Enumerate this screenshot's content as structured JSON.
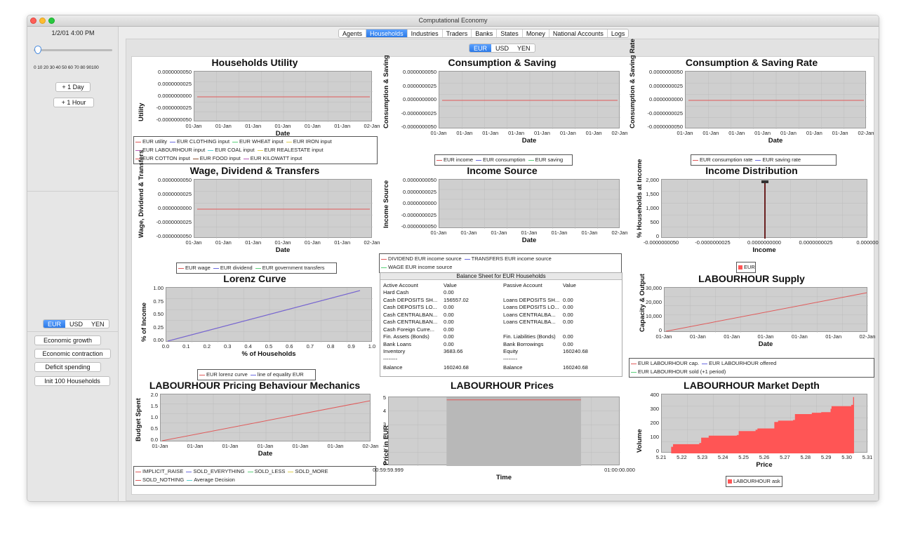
{
  "window": {
    "title": "Computational Economy"
  },
  "sidebar": {
    "date": "1/2/01 4:00 PM",
    "slider_ticks": "0 10 20 30 40 50 60 70 80 90100",
    "buttons": [
      "+ 1 Day",
      "+ 1 Hour"
    ],
    "currency_tabs": [
      "EUR",
      "USD",
      "YEN"
    ],
    "action_buttons": [
      "Economic growth",
      "Economic contraction",
      "Deficit spending",
      "Init 100 Households"
    ]
  },
  "nav": {
    "tabs": [
      "Agents",
      "Households",
      "Industries",
      "Traders",
      "Banks",
      "States",
      "Money",
      "National Accounts",
      "Logs"
    ],
    "active": "Households"
  },
  "currency": {
    "tabs": [
      "EUR",
      "USD",
      "YEN"
    ],
    "active": "EUR"
  },
  "colors": {
    "red": "#e05a5a",
    "blue": "#6a6ae0",
    "green": "#5ad07a",
    "yellow": "#e0d050",
    "purple": "#b85ab8",
    "cyan": "#5ad0d0",
    "brown": "#8a5030",
    "bar": "#ff5555"
  },
  "charts": {
    "utility": {
      "title": "Households Utility",
      "ylabel": "Utility",
      "xlabel": "Date",
      "yticks": [
        "0.0000000050",
        "0.0000000025",
        "0.0000000000",
        "-0.0000000025",
        "-0.0000000050"
      ],
      "xticks": [
        "01-Jan",
        "01-Jan",
        "01-Jan",
        "01-Jan",
        "01-Jan",
        "01-Jan",
        "02-Jan"
      ],
      "legend": [
        [
          "EUR utility",
          "EUR CLOTHING input",
          "EUR WHEAT input",
          "EUR IRON input"
        ],
        [
          "EUR LABOURHOUR input",
          "EUR COAL input",
          "EUR REALESTATE input"
        ],
        [
          "EUR COTTON input",
          "EUR FOOD input",
          "EUR KILOWATT input"
        ]
      ]
    },
    "consumption": {
      "title": "Consumption & Saving",
      "ylabel": "Consumption & Saving",
      "xlabel": "Date",
      "yticks": [
        "0.0000000050",
        "0.0000000025",
        "0.0000000000",
        "-0.0000000025",
        "-0.0000000050"
      ],
      "xticks": [
        "01-Jan",
        "01-Jan",
        "01-Jan",
        "01-Jan",
        "01-Jan",
        "01-Jan",
        "01-Jan",
        "02-Jan"
      ],
      "legend": [
        "EUR income",
        "EUR consumption",
        "EUR saving"
      ]
    },
    "rate": {
      "title": "Consumption & Saving Rate",
      "ylabel": "Consumption & Saving Rate",
      "xlabel": "Date",
      "yticks": [
        "0.0000000050",
        "0.0000000025",
        "0.0000000000",
        "-0.0000000025",
        "-0.0000000050"
      ],
      "xticks": [
        "01-Jan",
        "01-Jan",
        "01-Jan",
        "01-Jan",
        "01-Jan",
        "01-Jan",
        "01-Jan",
        "02-Jan"
      ],
      "legend": [
        "EUR consumption rate",
        "EUR saving rate"
      ]
    },
    "wage": {
      "title": "Wage, Dividend & Transfers",
      "ylabel": "Wage, Dividend & Transfers",
      "xlabel": "Date",
      "yticks": [
        "0.0000000050",
        "0.0000000025",
        "0.0000000000",
        "-0.0000000025",
        "-0.0000000050"
      ],
      "xticks": [
        "01-Jan",
        "01-Jan",
        "01-Jan",
        "01-Jan",
        "01-Jan",
        "01-Jan",
        "02-Jan"
      ],
      "legend": [
        "EUR wage",
        "EUR dividend",
        "EUR government transfers"
      ]
    },
    "income_source": {
      "title": "Income Source",
      "ylabel": "Income Source",
      "xlabel": "Date",
      "yticks": [
        "0.0000000050",
        "0.0000000025",
        "0.0000000000",
        "-0.0000000025",
        "-0.0000000050"
      ],
      "xticks": [
        "01-Jan",
        "01-Jan",
        "01-Jan",
        "01-Jan",
        "01-Jan",
        "01-Jan",
        "02-Jan"
      ],
      "legend": [
        [
          "DIVIDEND EUR income source",
          "TRANSFERS EUR income source"
        ],
        [
          "WAGE EUR income source"
        ]
      ]
    },
    "distribution": {
      "title": "Income Distribution",
      "ylabel": "% Households at Income",
      "xlabel": "Income",
      "yticks": [
        "2,000",
        "1,500",
        "1,000",
        "500",
        "0"
      ],
      "xticks": [
        "-0.0000000050",
        "-0.0000000025",
        "0.0000000000",
        "0.0000000025",
        "0.000000"
      ],
      "legend": [
        "EUR"
      ]
    },
    "lorenz": {
      "title": "Lorenz Curve",
      "ylabel": "% of Income",
      "xlabel": "% of Households",
      "yticks": [
        "1.00",
        "0.75",
        "0.50",
        "0.25",
        "0.00"
      ],
      "xticks": [
        "0.0",
        "0.1",
        "0.2",
        "0.3",
        "0.4",
        "0.5",
        "0.6",
        "0.7",
        "0.8",
        "0.9",
        "1.0"
      ],
      "legend": [
        "EUR lorenz curve",
        "line of equality EUR"
      ]
    },
    "labour_supply": {
      "title": "LABOURHOUR Supply",
      "ylabel": "Capacity & Output",
      "xlabel": "Date",
      "yticks": [
        "30,000",
        "20,000",
        "10,000",
        "0"
      ],
      "xticks": [
        "01-Jan",
        "01-Jan",
        "01-Jan",
        "01-Jan",
        "01-Jan",
        "01-Jan",
        "02-Jan"
      ],
      "legend": [
        [
          "EUR LABOURHOUR cap.",
          "EUR LABOURHOUR offered"
        ],
        [
          "EUR LABOURHOUR sold (+1 period)"
        ]
      ]
    },
    "pricing": {
      "title": "LABOURHOUR Pricing Behaviour Mechanics",
      "ylabel": "Budget Spent",
      "xlabel": "Date",
      "yticks": [
        "2.0",
        "1.5",
        "1.0",
        "0.5",
        "0.0"
      ],
      "xticks": [
        "01-Jan",
        "01-Jan",
        "01-Jan",
        "01-Jan",
        "01-Jan",
        "01-Jan",
        "02-Jan"
      ],
      "legend": [
        [
          "IMPLICIT_RAISE",
          "SOLD_EVERYTHING",
          "SOLD_LESS",
          "SOLD_MORE"
        ],
        [
          "SOLD_NOTHING",
          "Average Decision"
        ]
      ]
    },
    "prices": {
      "title": "LABOURHOUR Prices",
      "ylabel": "Price in EUR",
      "xlabel": "Time",
      "yticks": [
        "5",
        "4",
        "3",
        "2",
        "1",
        "0"
      ],
      "xticks": [
        "00:59:59.999",
        "01:00:00.000"
      ]
    },
    "depth": {
      "title": "LABOURHOUR Market Depth",
      "ylabel": "Volume",
      "xlabel": "Price",
      "yticks": [
        "400",
        "300",
        "200",
        "100",
        "0"
      ],
      "xticks": [
        "5.21",
        "5.22",
        "5.23",
        "5.24",
        "5.25",
        "5.26",
        "5.27",
        "5.28",
        "5.29",
        "5.30",
        "5.31"
      ],
      "legend": [
        "LABOURHOUR ask"
      ]
    }
  },
  "chart_data": [
    {
      "type": "line",
      "title": "Lorenz Curve",
      "xlabel": "% of Households",
      "ylabel": "% of Income",
      "xlim": [
        0,
        1
      ],
      "ylim": [
        0,
        1
      ],
      "series": [
        {
          "name": "EUR lorenz curve",
          "x": [
            0,
            1
          ],
          "y": [
            0,
            1
          ]
        },
        {
          "name": "line of equality EUR",
          "x": [
            0,
            1
          ],
          "y": [
            0,
            1
          ]
        }
      ]
    },
    {
      "type": "line",
      "title": "LABOURHOUR Supply",
      "xlabel": "Date",
      "ylabel": "Capacity & Output",
      "ylim": [
        0,
        35000
      ],
      "series": [
        {
          "name": "EUR LABOURHOUR cap.",
          "x": [
            0,
            1
          ],
          "y": [
            0,
            32000
          ]
        }
      ]
    },
    {
      "type": "line",
      "title": "LABOURHOUR Pricing Behaviour Mechanics",
      "xlabel": "Date",
      "ylabel": "Budget Spent",
      "ylim": [
        0,
        2.25
      ],
      "series": [
        {
          "name": "IMPLICIT_RAISE",
          "x": [
            0,
            1
          ],
          "y": [
            0,
            2.0
          ]
        }
      ]
    },
    {
      "type": "line",
      "title": "LABOURHOUR Prices",
      "xlabel": "Time",
      "ylabel": "Price in EUR",
      "ylim": [
        0,
        5.3
      ],
      "series": [
        {
          "values": [
            5.1,
            5.1
          ]
        }
      ]
    },
    {
      "type": "area",
      "title": "LABOURHOUR Market Depth",
      "xlabel": "Price",
      "ylabel": "Volume",
      "xlim": [
        5.2,
        5.31
      ],
      "ylim": [
        0,
        450
      ],
      "series": [
        {
          "name": "LABOURHOUR ask",
          "x": [
            5.205,
            5.206,
            5.22,
            5.221,
            5.225,
            5.24,
            5.241,
            5.25,
            5.251,
            5.26,
            5.262,
            5.27,
            5.271,
            5.28,
            5.285,
            5.29,
            5.2905,
            5.3,
            5.301,
            5.302,
            5.3025
          ],
          "y": [
            50,
            70,
            80,
            120,
            135,
            140,
            170,
            180,
            190,
            240,
            250,
            255,
            300,
            310,
            315,
            340,
            360,
            360,
            370,
            430,
            440
          ]
        }
      ]
    },
    {
      "type": "bar",
      "title": "Income Distribution",
      "xlabel": "Income",
      "ylabel": "% Households at Income",
      "ylim": [
        0,
        2100
      ],
      "categories": [
        "0.0000000000"
      ],
      "values": [
        2000
      ]
    }
  ],
  "balance_sheet": {
    "title": "Balance Sheet for EUR Households",
    "headers": [
      "Active Account",
      "Value",
      "Passive Account",
      "Value"
    ],
    "rows": [
      [
        "Hard Cash",
        "0.00",
        "",
        ""
      ],
      [
        "Cash DEPOSITS SH...",
        "156557.02",
        "Loans DEPOSITS SH...",
        "0.00"
      ],
      [
        "Cash DEPOSITS LO...",
        "0.00",
        "Loans DEPOSITS LO...",
        "0.00"
      ],
      [
        "Cash CENTRALBAN...",
        "0.00",
        "Loans CENTRALBA...",
        "0.00"
      ],
      [
        "Cash CENTRALBAN...",
        "0.00",
        "Loans CENTRALBA...",
        "0.00"
      ],
      [
        "Cash Foreign Curre...",
        "0.00",
        "",
        ""
      ],
      [
        "Fin. Assets (Bonds)",
        "0.00",
        "Fin. Liabilities (Bonds)",
        "0.00"
      ],
      [
        "Bank Loans",
        "0.00",
        "Bank Borrowings",
        "0.00"
      ],
      [
        "Inventory",
        "3683.66",
        "Equity",
        "160240.68"
      ],
      [
        "--------",
        "",
        "--------",
        ""
      ],
      [
        "Balance",
        "160240.68",
        "Balance",
        "160240.68"
      ]
    ]
  }
}
